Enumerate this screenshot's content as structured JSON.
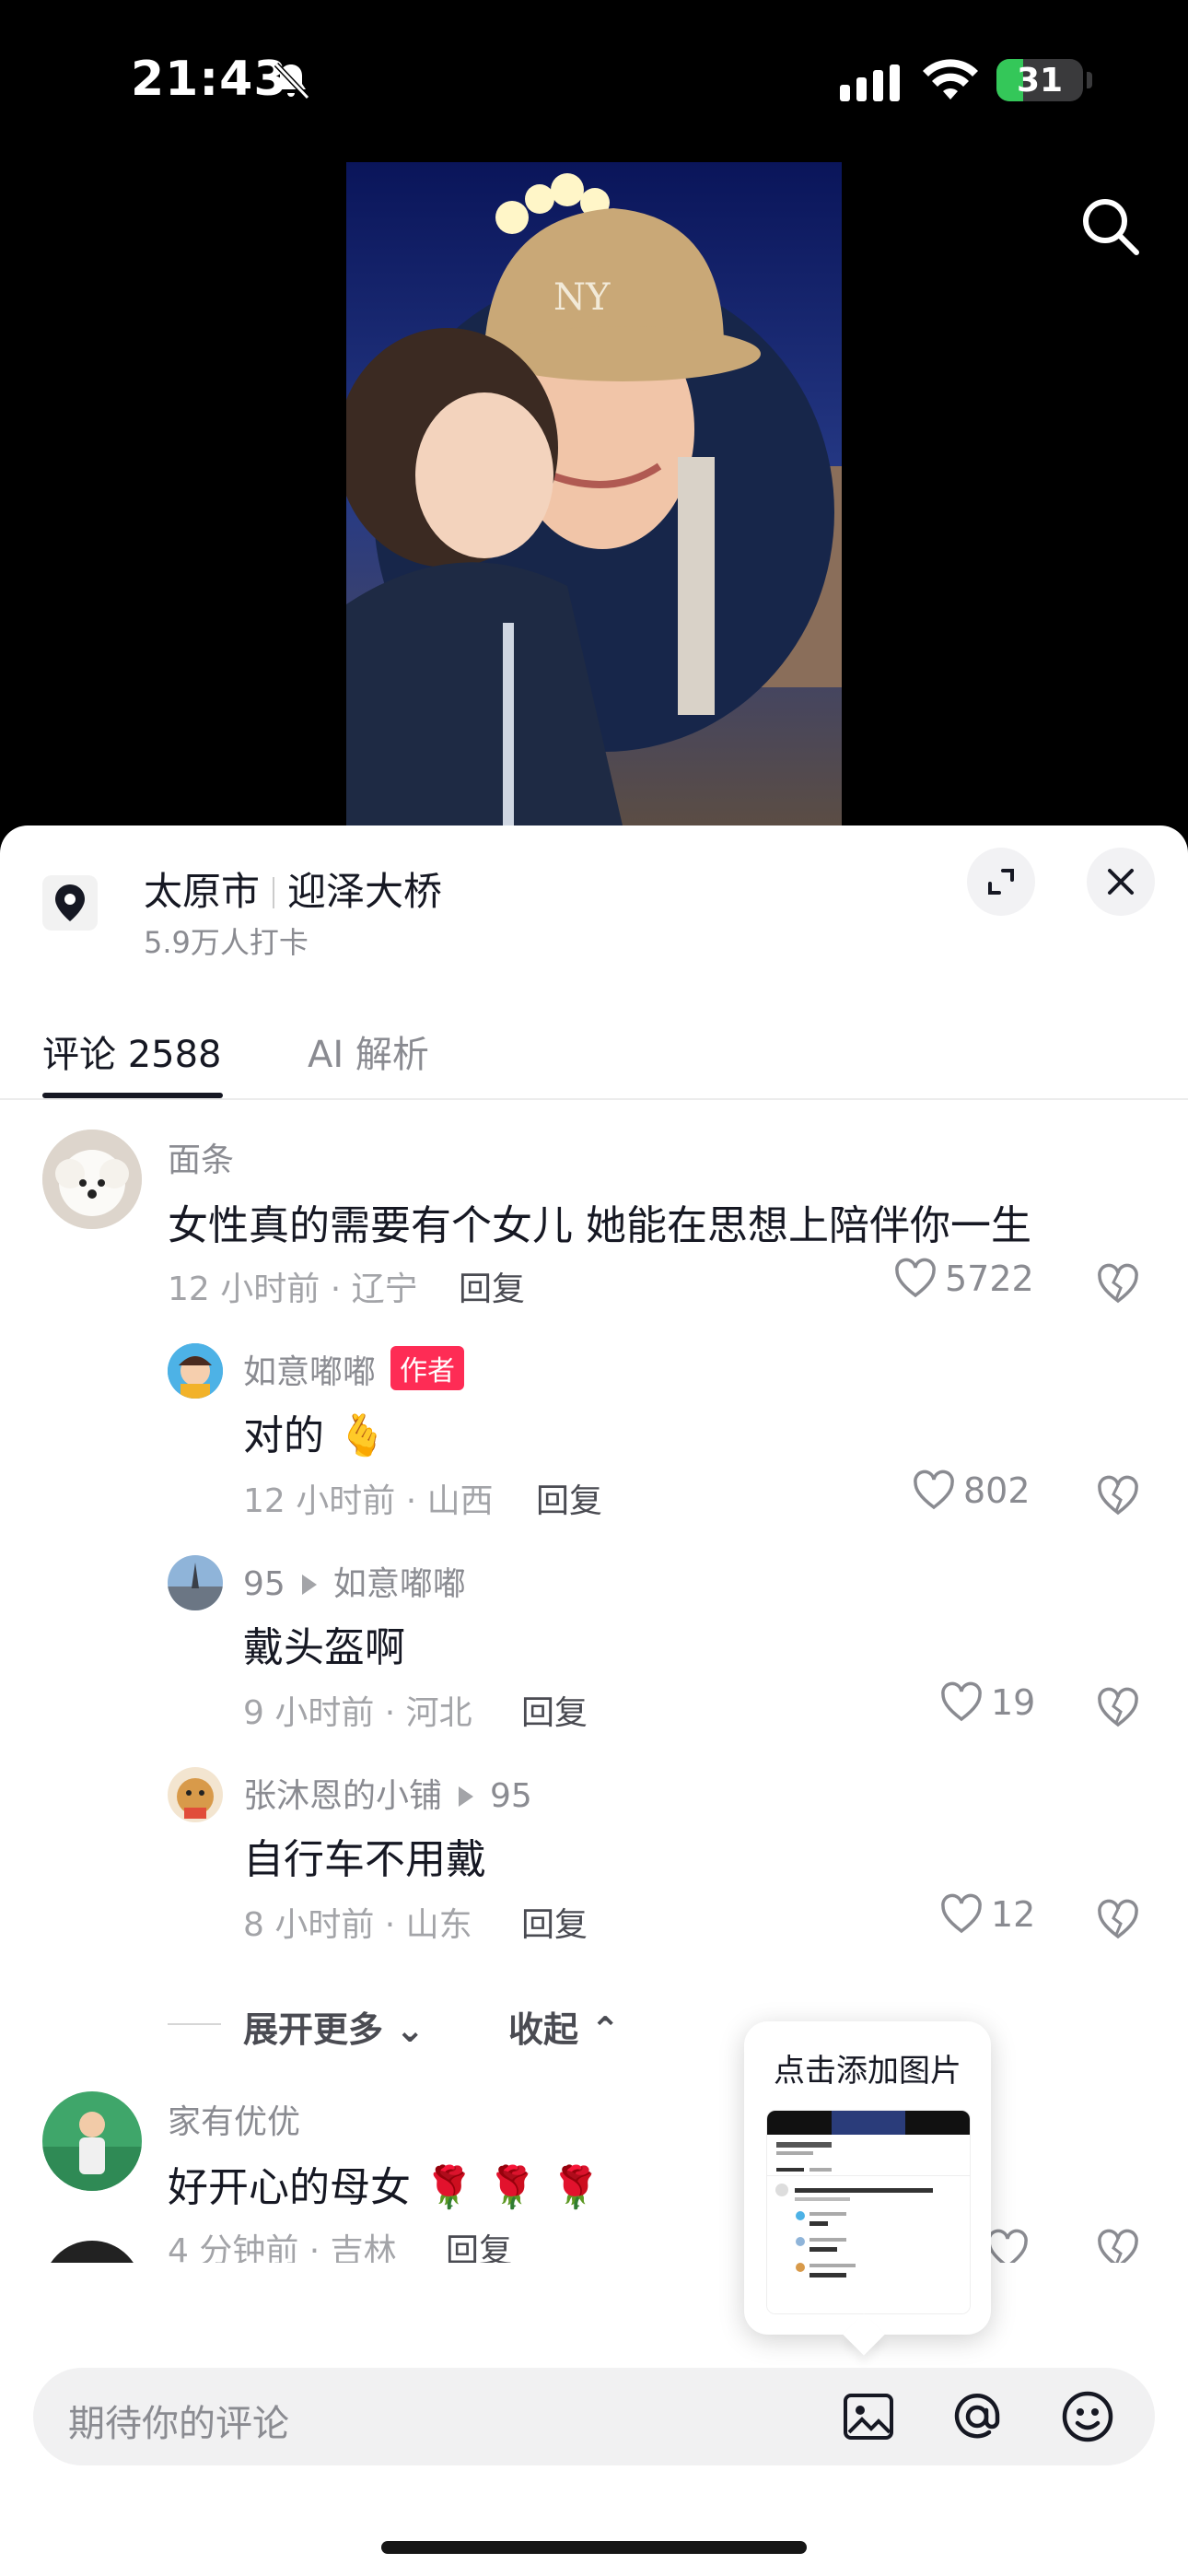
{
  "status_bar": {
    "time": "21:43",
    "battery": "31",
    "battery_level": 0.31,
    "icons": [
      "bell-slash-icon",
      "signal-icon",
      "wifi-icon",
      "battery-icon"
    ]
  },
  "video": {
    "search_icon": "search-icon"
  },
  "location": {
    "city": "太原市",
    "place": "迎泽大桥",
    "checkins": "5.9万人打卡",
    "icon": "location-pin-icon"
  },
  "tabs": {
    "comments": "评论 2588",
    "ai": "AI 解析"
  },
  "comments": [
    {
      "name": "面条",
      "text": "女性真的需要有个女儿 她能在思想上陪伴你一生",
      "meta": "12 小时前 · 辽宁",
      "reply": "回复",
      "likes": "5722"
    },
    {
      "name": "如意嘟嘟",
      "badge": "作者",
      "text": "对的 🫰",
      "meta": "12 小时前 · 山西",
      "reply": "回复",
      "likes": "802"
    },
    {
      "name": "95",
      "reply_to": "如意嘟嘟",
      "text": "戴头盔啊",
      "meta": "9 小时前 · 河北",
      "reply": "回复",
      "likes": "19"
    },
    {
      "name": "张沐恩的小铺",
      "reply_to": "95",
      "text": "自行车不用戴",
      "meta": "8 小时前 · 山东",
      "reply": "回复",
      "likes": "12"
    },
    {
      "name": "家有优优",
      "text": "好开心的母女 🌹 🌹 🌹",
      "meta": "4 分钟前 · 吉林",
      "reply": "回复"
    }
  ],
  "thread_controls": {
    "expand": "展开更多 ⌄",
    "collapse": "收起 ⌃"
  },
  "popup": {
    "title": "点击添加图片"
  },
  "input": {
    "placeholder": "期待你的评论",
    "icons": [
      "image-icon",
      "at-icon",
      "emoji-icon"
    ]
  },
  "colors": {
    "accent": "#fe2c55",
    "battery": "#34c759"
  }
}
